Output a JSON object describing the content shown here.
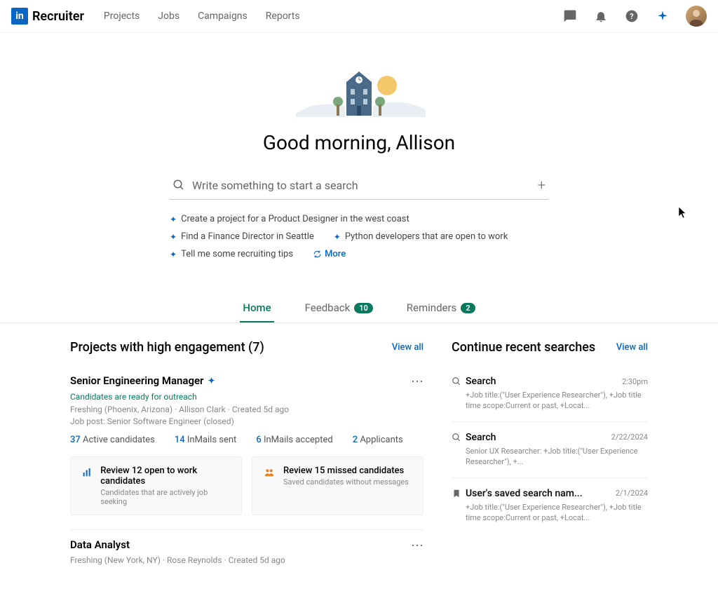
{
  "brand": {
    "logo_text": "in",
    "name": "Recruiter"
  },
  "nav": [
    "Projects",
    "Jobs",
    "Campaigns",
    "Reports"
  ],
  "greeting": "Good morning, Allison",
  "search": {
    "placeholder": "Write something to start a search"
  },
  "suggestions": [
    "Create a project for a Product Designer in the west coast",
    "Find a Finance Director in Seattle",
    "Python developers that are open to work",
    "Tell me some recruiting tips"
  ],
  "more_label": "More",
  "tabs": {
    "home": "Home",
    "feedback": "Feedback",
    "feedback_count": "10",
    "reminders": "Reminders",
    "reminders_count": "2"
  },
  "projects": {
    "title": "Projects with high engagement (7)",
    "view_all": "View all",
    "items": [
      {
        "title": "Senior Engineering Manager",
        "outreach": "Candidates are ready for outreach",
        "meta1": "Freshing (Phoenix, Arizona) · Allison Clark · Created 5d ago",
        "meta2": "Job post: Senior Software Engineer (closed)",
        "stats": [
          {
            "n": "37",
            "label": "Active candidates"
          },
          {
            "n": "14",
            "label": "InMails sent"
          },
          {
            "n": "6",
            "label": "InMails accepted"
          },
          {
            "n": "2",
            "label": "Applicants"
          }
        ],
        "actions": [
          {
            "title": "Review 12 open to work candidates",
            "sub": "Candidates that are actively job seeking"
          },
          {
            "title": "Review 15 missed candidates",
            "sub": "Saved candidates without messages"
          }
        ]
      },
      {
        "title": "Data Analyst",
        "meta1": "Freshing (New York, NY) · Rose Reynolds · Created 5d ago"
      }
    ]
  },
  "recent": {
    "title": "Continue recent searches",
    "view_all": "View all",
    "items": [
      {
        "name": "Search",
        "time": "2:30pm",
        "meta": "+Job title:(\"User Experience Researcher\"), +Job title time scope:Current or past, +Locat..."
      },
      {
        "name": "Search",
        "time": "2/22/2024",
        "meta": "Senior UX Researcher: +Job title:(\"User Experience Researcher\"), +..."
      },
      {
        "name": "User's saved search nam...",
        "time": "2/1/2024",
        "meta": "+Job title:(\"User Experience Researcher\"), +Job title time scope:Current or past, +Locat..."
      }
    ]
  }
}
